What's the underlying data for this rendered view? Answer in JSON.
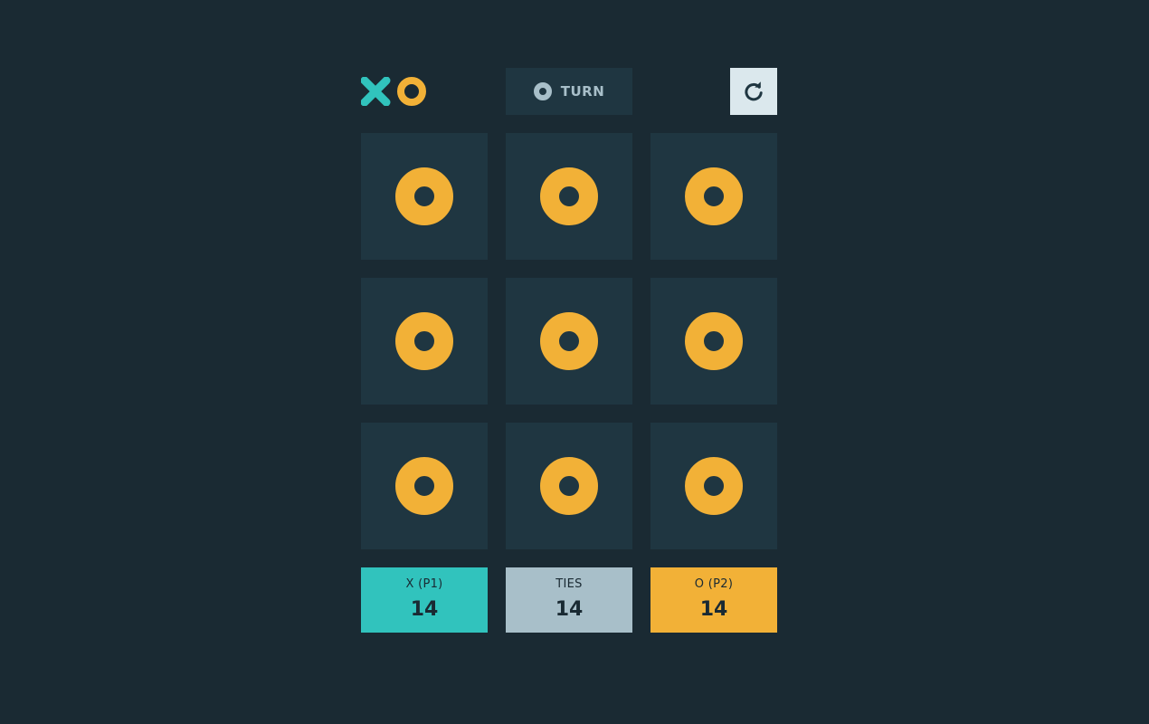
{
  "colors": {
    "background": "#1a2a33",
    "tile": "#1f3641",
    "x_accent": "#31c3bd",
    "o_accent": "#f2b137",
    "silver": "#a8bfc9",
    "restart_bg": "#dbe8ed"
  },
  "header": {
    "logo_icons": [
      "x-mark-icon",
      "o-mark-icon"
    ],
    "turn": {
      "mark": "O",
      "label": "TURN"
    },
    "restart_icon": "restart-icon"
  },
  "board": {
    "cells": [
      "O",
      "O",
      "O",
      "O",
      "O",
      "O",
      "O",
      "O",
      "O"
    ]
  },
  "scores": [
    {
      "label": "X (P1)",
      "value": "14",
      "color": "#31c3bd"
    },
    {
      "label": "TIES",
      "value": "14",
      "color": "#a8bfc9"
    },
    {
      "label": "O (P2)",
      "value": "14",
      "color": "#f2b137"
    }
  ]
}
